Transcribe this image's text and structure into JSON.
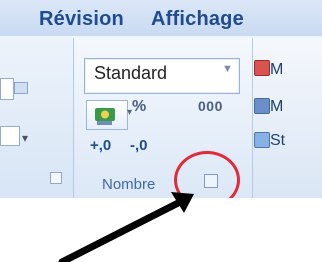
{
  "tabs": {
    "revision": "Révision",
    "affichage": "Affichage"
  },
  "number_group": {
    "format_value": "Standard",
    "percent_label": "%",
    "thousands_label": "000",
    "increase_decimal_label": "+,0",
    "decrease_decimal_label": "-,0",
    "group_label": "Nombre"
  },
  "right_group": {
    "items": [
      "M",
      "M",
      "St"
    ]
  }
}
